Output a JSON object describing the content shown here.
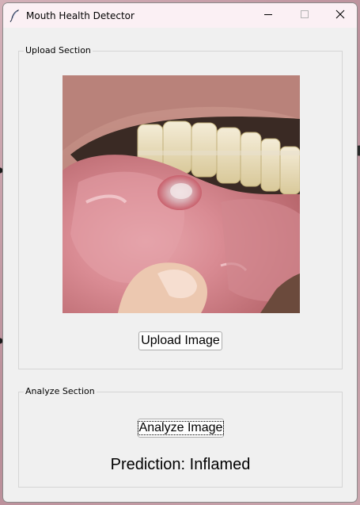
{
  "window": {
    "title": "Mouth Health Detector",
    "icon": "feather-icon",
    "controls": [
      "minimize-icon",
      "maximize-icon",
      "close-icon"
    ]
  },
  "upload_section": {
    "legend": "Upload Section",
    "image_content": "photo of inflamed lower lip with ulcer",
    "upload_button_label": "Upload Image"
  },
  "analyze_section": {
    "legend": "Analyze Section",
    "analyze_button_label": "Analyze Image",
    "prediction_text": "Prediction: Inflamed"
  },
  "colors": {
    "window_bg": "#f0f0f0",
    "titlebar_bg": "#fbf0f4",
    "button_bg": "#fdfdfd",
    "button_border": "#adadad"
  }
}
